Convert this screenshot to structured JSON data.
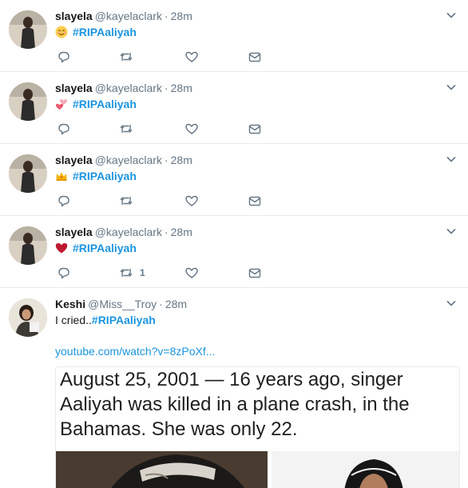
{
  "tweets": [
    {
      "name": "slayela",
      "handle": "@kayelaclark",
      "separator": "·",
      "time": "28m",
      "emoji": "relieved-face-emoji",
      "hashtag": "#RIPAaliyah",
      "retweet_count": ""
    },
    {
      "name": "slayela",
      "handle": "@kayelaclark",
      "separator": "·",
      "time": "28m",
      "emoji": "two-hearts-emoji",
      "hashtag": "#RIPAaliyah",
      "retweet_count": ""
    },
    {
      "name": "slayela",
      "handle": "@kayelaclark",
      "separator": "·",
      "time": "28m",
      "emoji": "crown-emoji",
      "hashtag": "#RIPAaliyah",
      "retweet_count": ""
    },
    {
      "name": "slayela",
      "handle": "@kayelaclark",
      "separator": "·",
      "time": "28m",
      "emoji": "red-heart-emoji",
      "hashtag": "#RIPAaliyah",
      "retweet_count": "1"
    }
  ],
  "keshi_tweet": {
    "name": "Keshi",
    "handle": "@Miss__Troy",
    "separator": "·",
    "time": "28m",
    "text": "I cried..",
    "hashtag": "#RIPAaliyah",
    "link": "youtube.com/watch?v=8zPoXf...",
    "card_text": "August 25, 2001 — 16 years ago, singer Aaliyah was killed in a plane crash, in the Bahamas. She was only 22."
  },
  "colors": {
    "link": "#1b95e0",
    "muted": "#657786",
    "divider": "#e6ecf0"
  }
}
